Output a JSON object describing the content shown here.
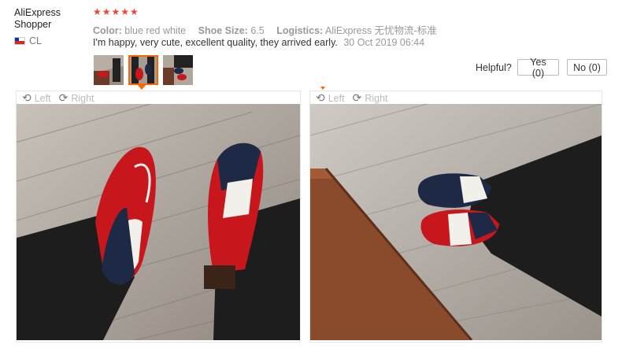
{
  "reviewer": {
    "name": "AliExpress Shopper",
    "country_code": "CL"
  },
  "review": {
    "stars": "★★★★★",
    "color_label": "Color:",
    "color_value": "blue red white",
    "size_label": "Shoe Size:",
    "size_value": "6.5",
    "logistics_label": "Logistics:",
    "logistics_value": "AliExpress 无忧物流-标准",
    "text": "I'm happy, very cute, excellent quality, they arrived early.",
    "date": "30 Oct 2019 06:44"
  },
  "helpful": {
    "label": "Helpful?",
    "yes": "Yes (0)",
    "no": "No (0)"
  },
  "viewer": {
    "left_label": "Left",
    "right_label": "Right"
  },
  "colors": {
    "star": "#f44336",
    "accent": "#ff6600",
    "shoe_red": "#c8161d",
    "shoe_navy": "#1e2a45"
  }
}
